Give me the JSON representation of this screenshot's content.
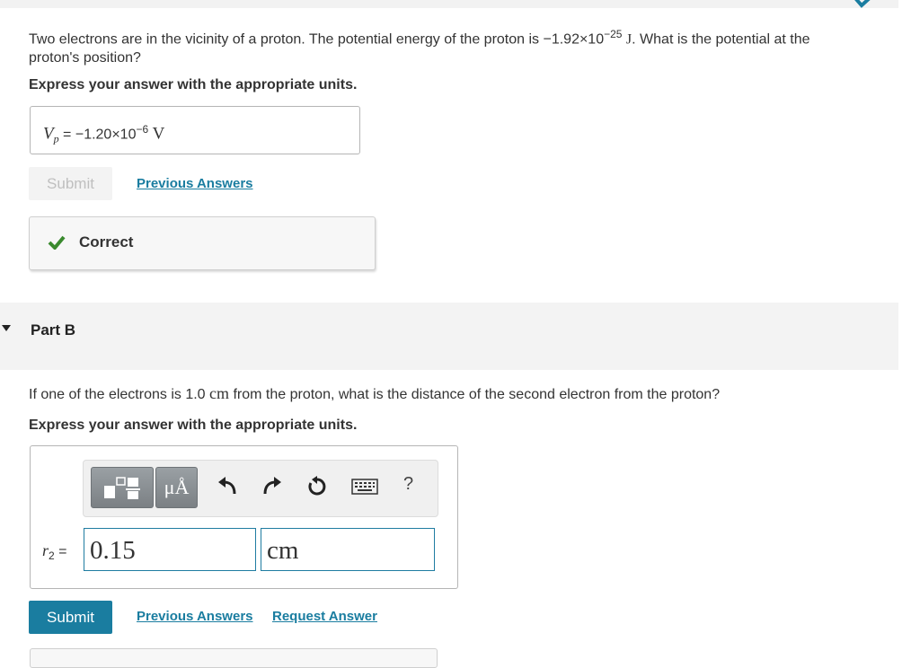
{
  "partA": {
    "question_part1": "Two electrons are in the vicinity of a proton. The potential energy of the proton is −1.92×10",
    "question_exp": "−25",
    "question_unit": "J",
    "question_part2": ". What is the potential at the",
    "question_line2": "proton's position?",
    "instruction": "Express your answer with the appropriate units.",
    "answer_var": "V",
    "answer_sub": "p",
    "answer_eq": " = ",
    "answer_value": "−1.20×10",
    "answer_exp": "−6",
    "answer_unit": "V",
    "submit_label": "Submit",
    "previous_answers_label": "Previous Answers",
    "feedback_text": "Correct"
  },
  "partB": {
    "title": "Part B",
    "question_part1": "If one of the electrons is 1.0 ",
    "question_unit": "cm",
    "question_part2": " from the proton, what is the distance of the second electron from the proton?",
    "instruction": "Express your answer with the appropriate units.",
    "toolbar_units_label": "μÅ",
    "help_label": "?",
    "answer_var": "r",
    "answer_sub": "2",
    "answer_eq": " = ",
    "value_input": "0.15",
    "unit_input": "cm",
    "submit_label": "Submit",
    "previous_answers_label": "Previous Answers",
    "request_answer_label": "Request Answer"
  },
  "colors": {
    "accent": "#1a7da0",
    "correct_green": "#3a8a2e",
    "part_bar_bg": "#f3f3f3"
  }
}
